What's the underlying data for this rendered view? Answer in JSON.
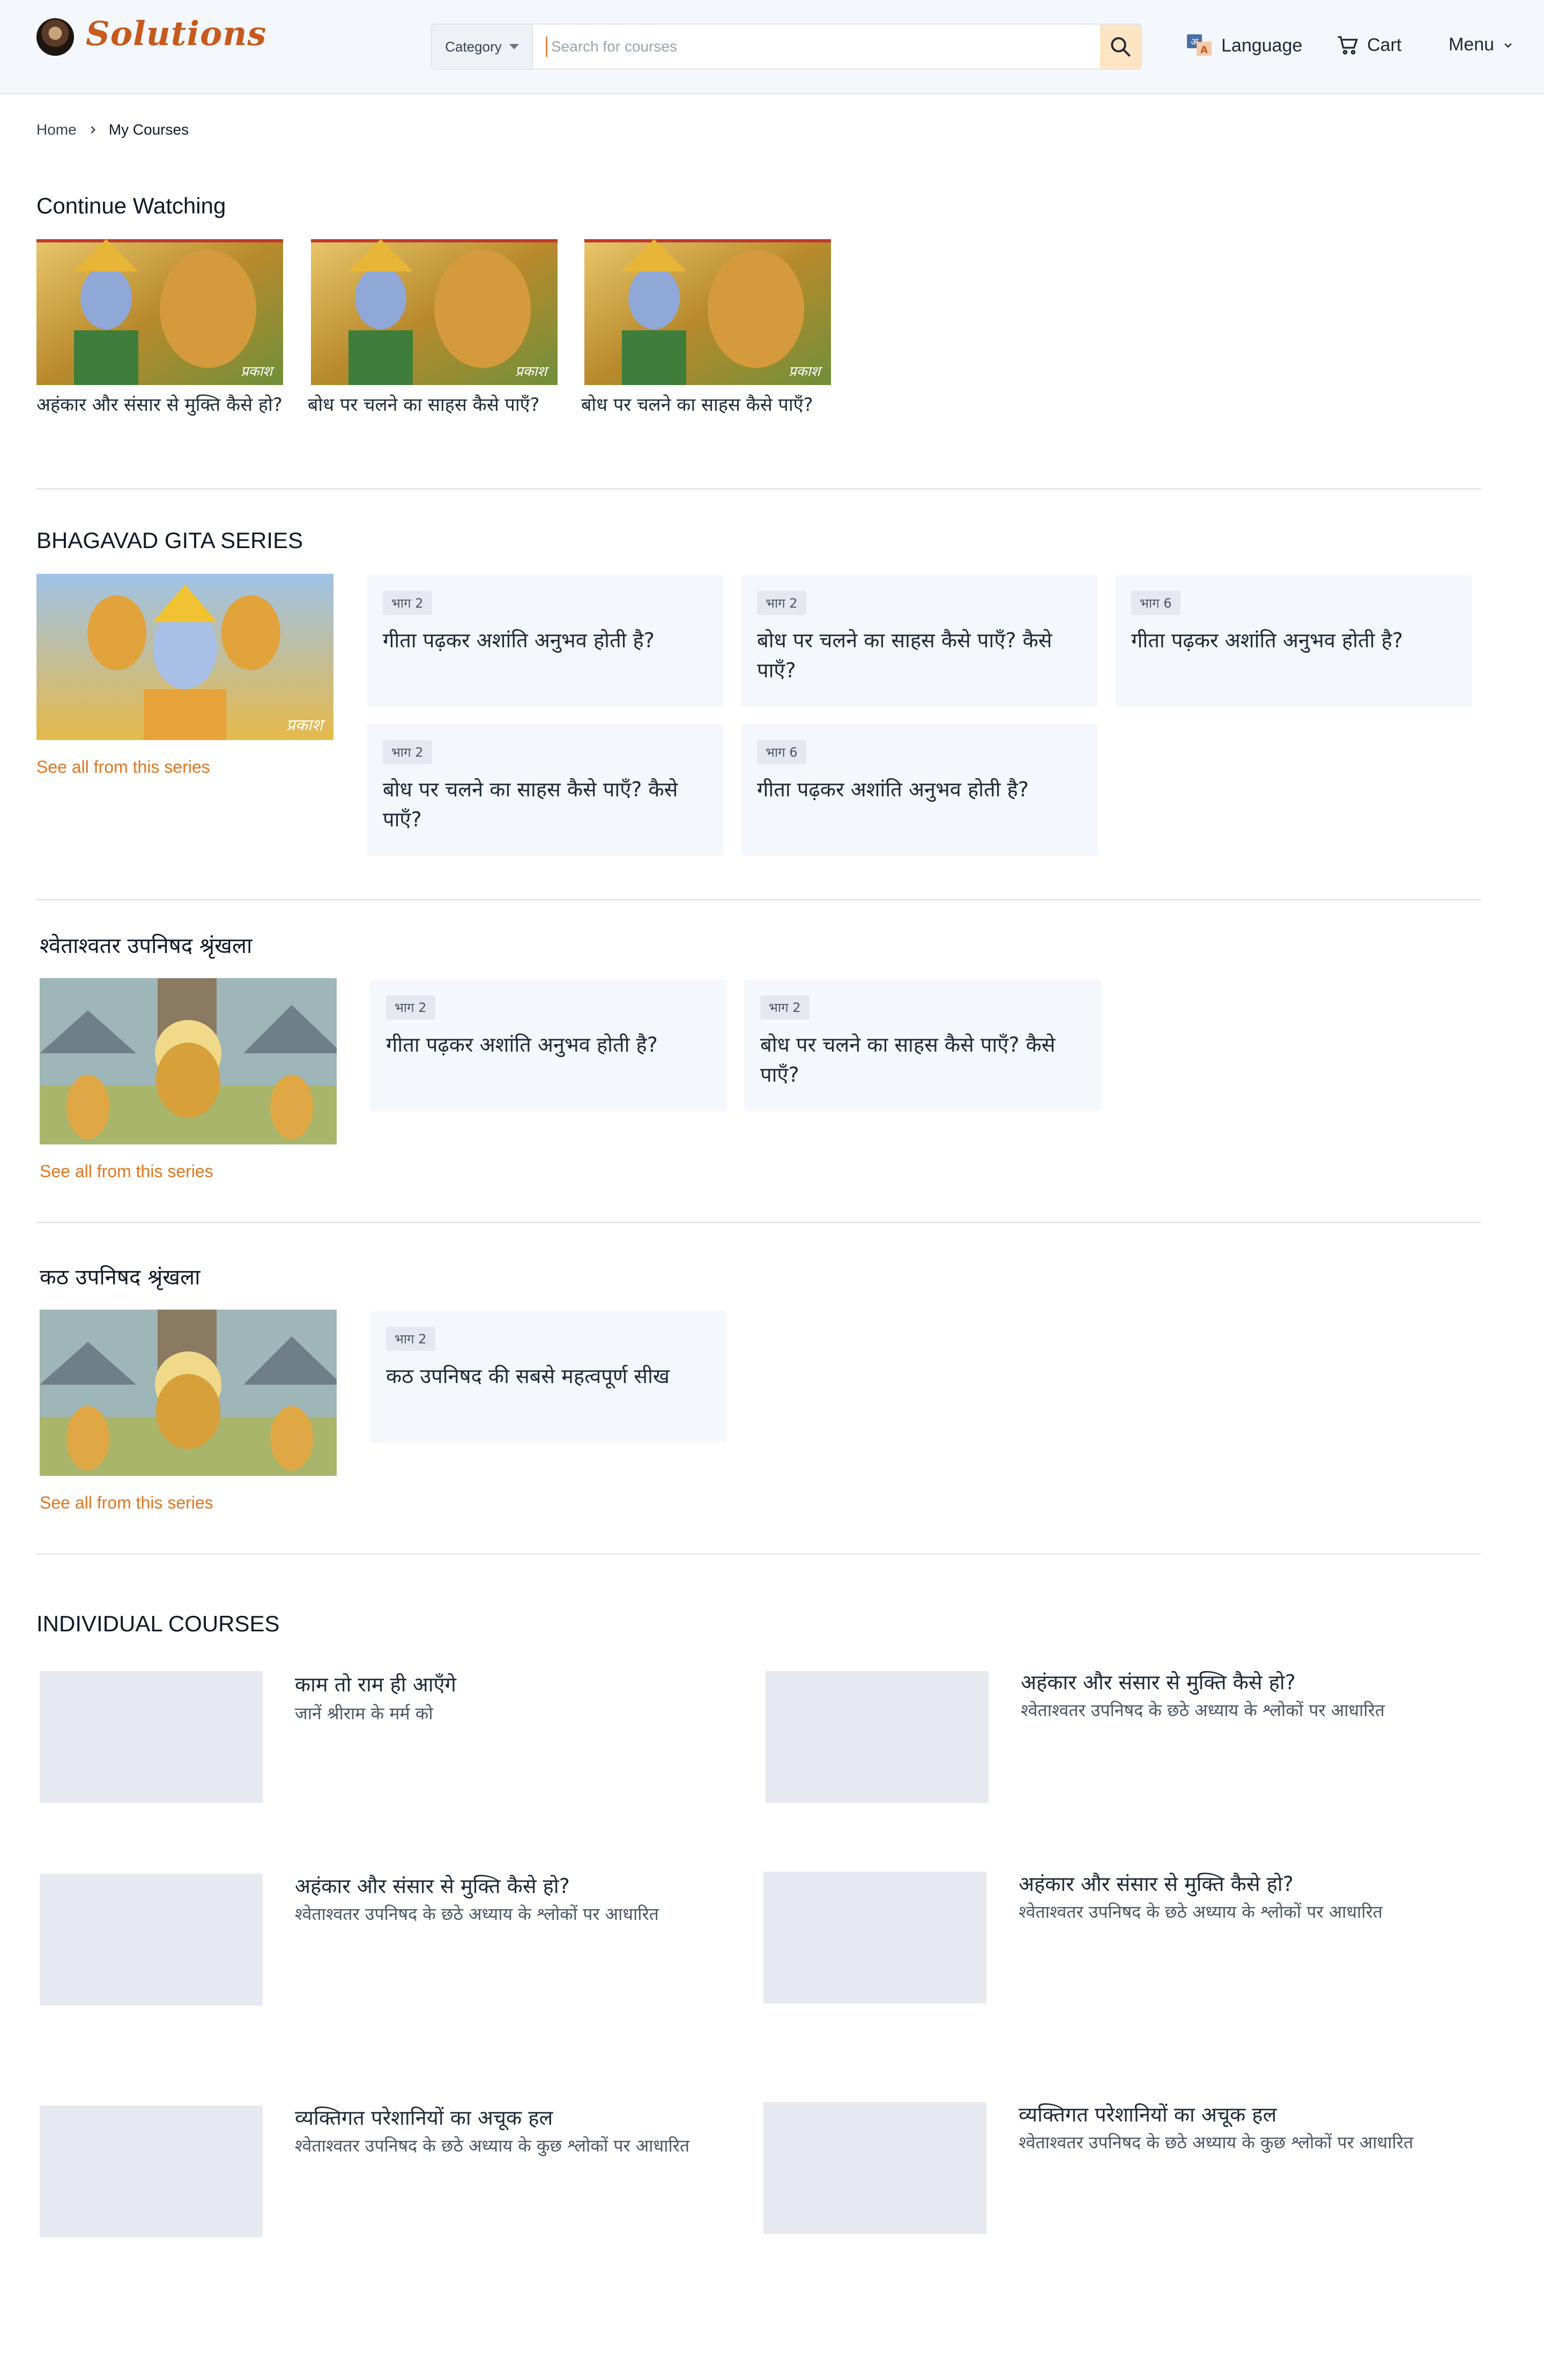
{
  "brand": {
    "name": "Solutions"
  },
  "search": {
    "category_label": "Category",
    "placeholder": "Search for courses"
  },
  "nav": {
    "language": "Language",
    "cart": "Cart",
    "menu": "Menu"
  },
  "breadcrumb": {
    "home": "Home",
    "current": "My Courses"
  },
  "continue_watching": {
    "title": "Continue Watching",
    "items": [
      {
        "caption": "अहंकार और संसार से मुक्ति कैसे हो?"
      },
      {
        "caption": "बोध पर चलने का साहस कैसे पाएँ?"
      },
      {
        "caption": "बोध पर चलने का साहस कैसे पाएँ?"
      }
    ]
  },
  "series": [
    {
      "title": "BHAGAVAD GITA SERIES",
      "see_all": "See all from this series",
      "episodes": [
        {
          "badge": "भाग 2",
          "title": "गीता पढ़कर अशांति अनुभव होती है?"
        },
        {
          "badge": "भाग 2",
          "title": "बोध पर चलने का साहस कैसे पाएँ? कैसे पाएँ?"
        },
        {
          "badge": "भाग 6",
          "title": "गीता पढ़कर अशांति अनुभव होती है?"
        },
        {
          "badge": "भाग 2",
          "title": "बोध पर चलने का साहस कैसे पाएँ? कैसे पाएँ?"
        },
        {
          "badge": "भाग 6",
          "title": "गीता पढ़कर अशांति अनुभव होती है?"
        }
      ]
    },
    {
      "title": "श्वेताश्वतर उपनिषद श्रृंखला",
      "see_all": "See all from this series",
      "episodes": [
        {
          "badge": "भाग 2",
          "title": "गीता पढ़कर अशांति अनुभव होती है?"
        },
        {
          "badge": "भाग 2",
          "title": "बोध पर चलने का साहस कैसे पाएँ? कैसे पाएँ?"
        }
      ]
    },
    {
      "title": "कठ उपनिषद श्रृंखला",
      "see_all": "See all from this series",
      "episodes": [
        {
          "badge": "भाग 2",
          "title": "कठ उपनिषद की सबसे महत्वपूर्ण सीख"
        }
      ]
    }
  ],
  "individual_courses": {
    "title": "INDIVIDUAL COURSES",
    "items": [
      {
        "title": "काम तो राम ही आएँगे",
        "subtitle": "जानें श्रीराम के मर्म को"
      },
      {
        "title": "अहंकार और संसार से मुक्ति कैसे हो?",
        "subtitle": "श्वेताश्वतर उपनिषद के छठे अध्याय के श्लोकों पर आधारित"
      },
      {
        "title": "अहंकार और संसार से मुक्ति कैसे हो?",
        "subtitle": "श्वेताश्वतर उपनिषद के छठे अध्याय के श्लोकों पर आधारित"
      },
      {
        "title": "अहंकार और संसार से मुक्ति कैसे हो?",
        "subtitle": "श्वेताश्वतर उपनिषद के छठे अध्याय के श्लोकों पर आधारित"
      },
      {
        "title": "व्यक्तिगत परेशानियों का अचूक हल",
        "subtitle": "श्वेताश्वतर उपनिषद के छठे अध्याय के कुछ श्लोकों पर आधारित"
      },
      {
        "title": "व्यक्तिगत परेशानियों का अचूक हल",
        "subtitle": "श्वेताश्वतर उपनिषद के छठे अध्याय के कुछ श्लोकों पर आधारित"
      }
    ]
  },
  "colors": {
    "accent": "#e0761f",
    "brand": "#c65a1e",
    "card_bg": "#f4f7fb",
    "placeholder_bg": "#e6eaf0"
  },
  "icons": [
    "logo-avatar",
    "chevron-down-icon",
    "search-icon",
    "language-icon",
    "cart-icon",
    "chevron-right-icon"
  ]
}
